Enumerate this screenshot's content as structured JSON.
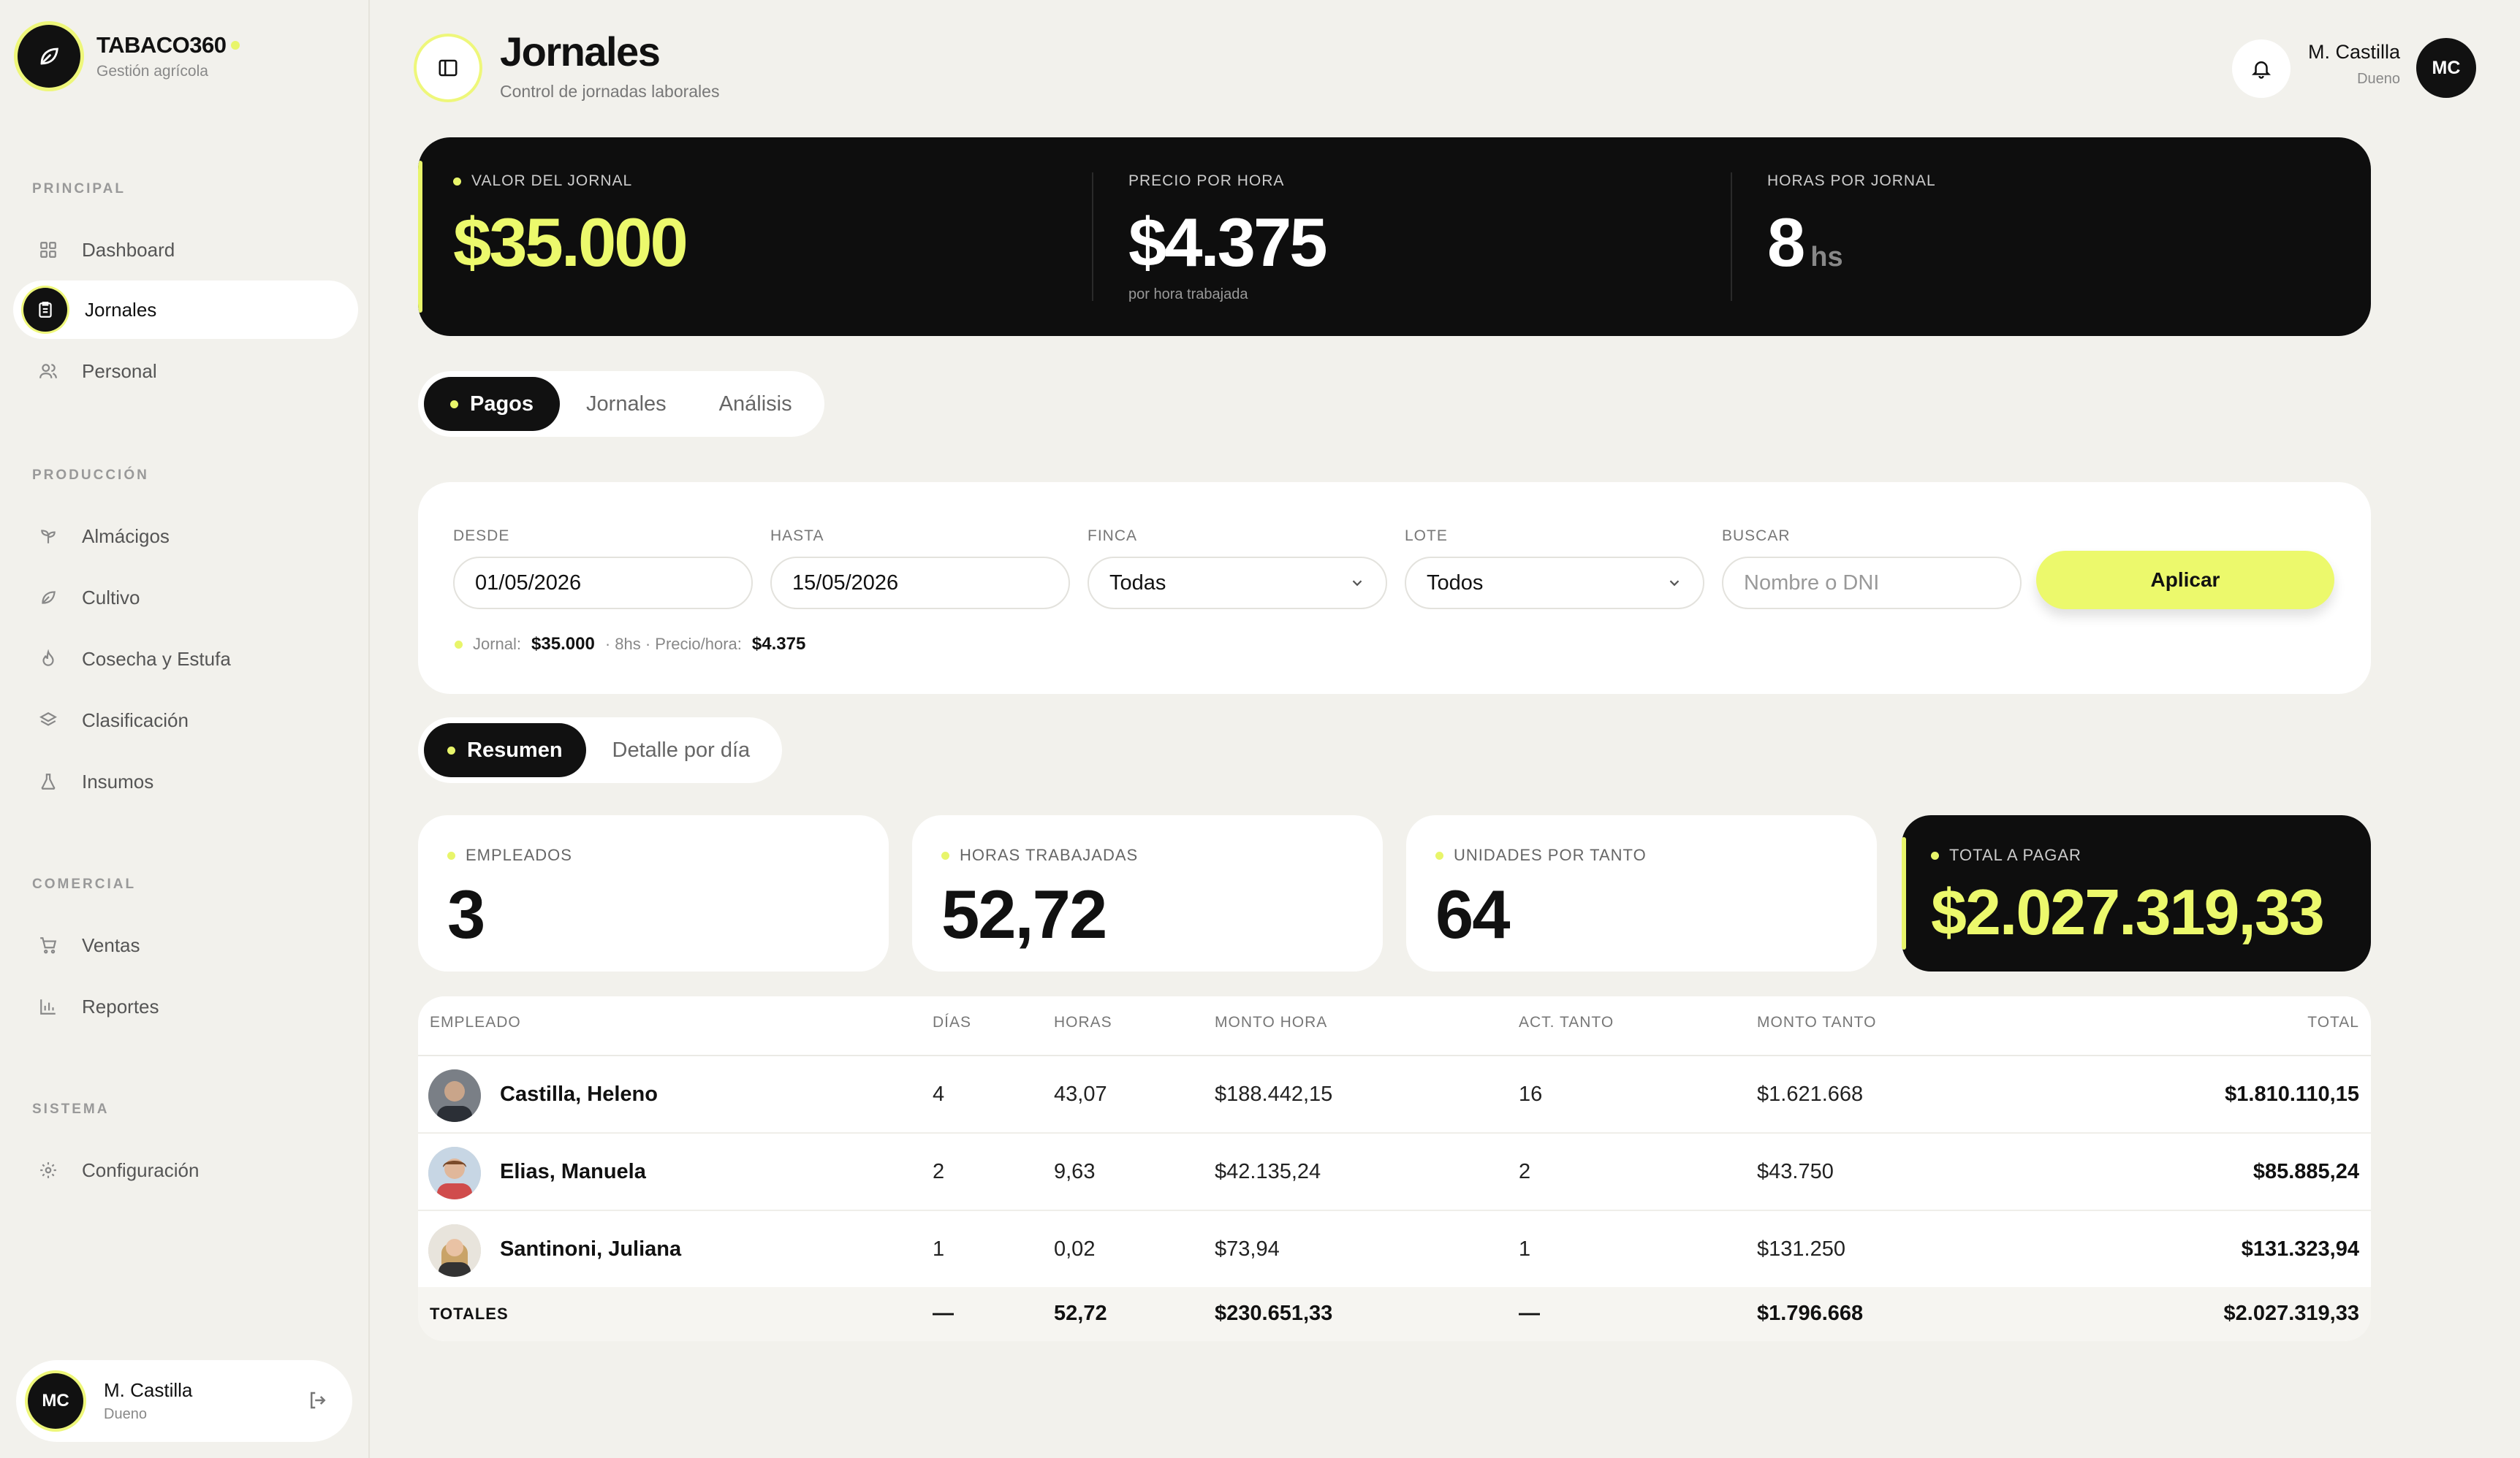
{
  "brand": {
    "name": "TABACO360",
    "subtitle": "Gestión agrícola"
  },
  "sidebar": {
    "sections": [
      {
        "label": "PRINCIPAL",
        "items": [
          {
            "label": "Dashboard",
            "icon": "grid-icon"
          },
          {
            "label": "Jornales",
            "icon": "clipboard-icon",
            "active": true
          },
          {
            "label": "Personal",
            "icon": "users-icon"
          }
        ]
      },
      {
        "label": "PRODUCCIÓN",
        "items": [
          {
            "label": "Almácigos",
            "icon": "sprout-icon"
          },
          {
            "label": "Cultivo",
            "icon": "leaf-icon"
          },
          {
            "label": "Cosecha y Estufa",
            "icon": "flame-icon"
          },
          {
            "label": "Clasificación",
            "icon": "layers-icon"
          },
          {
            "label": "Insumos",
            "icon": "flask-icon"
          }
        ]
      },
      {
        "label": "COMERCIAL",
        "items": [
          {
            "label": "Ventas",
            "icon": "cart-icon"
          },
          {
            "label": "Reportes",
            "icon": "bar-chart-icon"
          }
        ]
      },
      {
        "label": "SISTEMA",
        "items": [
          {
            "label": "Configuración",
            "icon": "gear-icon"
          }
        ]
      }
    ],
    "user": {
      "initials": "MC",
      "name": "M. Castilla",
      "role": "Dueno"
    }
  },
  "header": {
    "title": "Jornales",
    "subtitle": "Control de jornadas laborales",
    "user": {
      "name": "M. Castilla",
      "role": "Dueno",
      "initials": "MC"
    }
  },
  "hero": {
    "valor_label": "VALOR DEL JORNAL",
    "valor": "$35.000",
    "precio_label": "PRECIO POR HORA",
    "precio": "$4.375",
    "precio_note": "por hora trabajada",
    "horas_label": "HORAS POR JORNAL",
    "horas": "8",
    "horas_unit": "hs"
  },
  "tabs": [
    "Pagos",
    "Jornales",
    "Análisis"
  ],
  "filters": {
    "desde_label": "DESDE",
    "desde": "01/05/2026",
    "hasta_label": "HASTA",
    "hasta": "15/05/2026",
    "finca_label": "FINCA",
    "finca": "Todas",
    "lote_label": "LOTE",
    "lote": "Todos",
    "buscar_label": "BUSCAR",
    "buscar_placeholder": "Nombre o DNI",
    "apply": "Aplicar",
    "info_jornal_label": "Jornal:",
    "info_jornal": "$35.000",
    "info_mid": "· 8hs · Precio/hora:",
    "info_precio": "$4.375"
  },
  "subtabs": [
    "Resumen",
    "Detalle por día"
  ],
  "stats": {
    "empleados_label": "EMPLEADOS",
    "empleados": "3",
    "horas_label": "HORAS TRABAJADAS",
    "horas": "52,72",
    "unidades_label": "UNIDADES POR TANTO",
    "unidades": "64",
    "total_label": "TOTAL A PAGAR",
    "total": "$2.027.319,33"
  },
  "table": {
    "headers": [
      "EMPLEADO",
      "DÍAS",
      "HORAS",
      "MONTO HORA",
      "ACT. TANTO",
      "MONTO TANTO",
      "TOTAL"
    ],
    "rows": [
      {
        "name": "Castilla, Heleno",
        "dias": "4",
        "horas": "43,07",
        "monto_hora": "$188.442,15",
        "act_tanto": "16",
        "monto_tanto": "$1.621.668",
        "total": "$1.810.110,15"
      },
      {
        "name": "Elias, Manuela",
        "dias": "2",
        "horas": "9,63",
        "monto_hora": "$42.135,24",
        "act_tanto": "2",
        "monto_tanto": "$43.750",
        "total": "$85.885,24"
      },
      {
        "name": "Santinoni, Juliana",
        "dias": "1",
        "horas": "0,02",
        "monto_hora": "$73,94",
        "act_tanto": "1",
        "monto_tanto": "$131.250",
        "total": "$131.323,94"
      }
    ],
    "totals": {
      "label": "TOTALES",
      "dias": "—",
      "horas": "52,72",
      "monto_hora": "$230.651,33",
      "act_tanto": "—",
      "monto_tanto": "$1.796.668",
      "total": "$2.027.319,33"
    }
  },
  "colors": {
    "accent": "#ecf96c",
    "dark": "#0e0e0e",
    "background": "#f2f1ec"
  }
}
